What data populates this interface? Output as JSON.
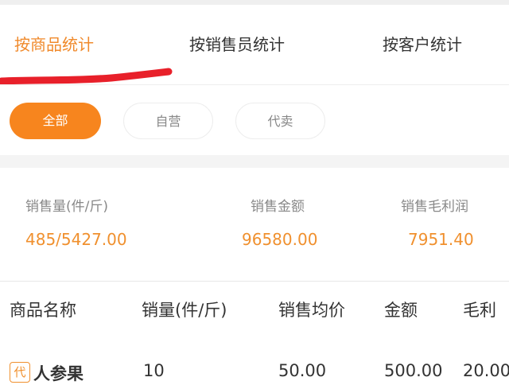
{
  "tabs": [
    {
      "label": "按商品统计",
      "active": true
    },
    {
      "label": "按销售员统计",
      "active": false
    },
    {
      "label": "按客户统计",
      "active": false
    }
  ],
  "filters": [
    {
      "label": "全部",
      "selected": true
    },
    {
      "label": "自营",
      "selected": false
    },
    {
      "label": "代卖",
      "selected": false
    }
  ],
  "summary": {
    "items": [
      {
        "label": "销售量(件/斤)",
        "value": "485/5427.00"
      },
      {
        "label": "销售金额",
        "value": "96580.00"
      },
      {
        "label": "销售毛利润",
        "value": "7951.40"
      }
    ]
  },
  "table": {
    "headers": [
      "商品名称",
      "销量(件/斤)",
      "销售均价",
      "金额",
      "毛利"
    ],
    "rows": [
      {
        "badge": "代",
        "name": "人参果",
        "qty": "10",
        "avg_price": "50.00",
        "amount": "500.00",
        "profit": "20.00"
      }
    ]
  },
  "colors": {
    "accent": "#f7851e",
    "accent_text": "#f0902e",
    "annotation_scribble": "#e8202a"
  }
}
